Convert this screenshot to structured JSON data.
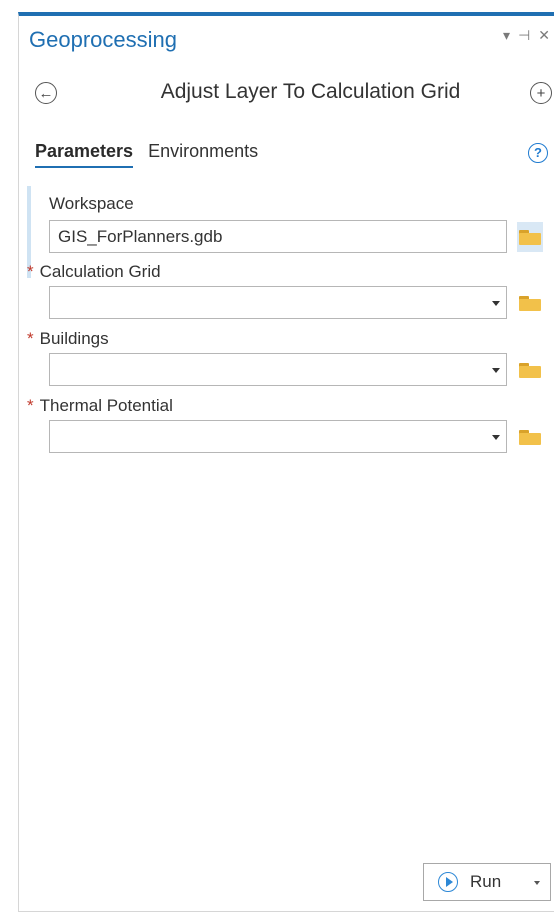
{
  "pane": {
    "title": "Geoprocessing",
    "controls": {
      "menu": "▾",
      "pin": "⊣",
      "close": "✕"
    }
  },
  "tool": {
    "title": "Adjust Layer To Calculation Grid"
  },
  "tabs": [
    {
      "label": "Parameters",
      "active": true
    },
    {
      "label": "Environments",
      "active": false
    }
  ],
  "help": "?",
  "parameters": [
    {
      "label": "Workspace",
      "required": false,
      "value": "GIS_ForPlanners.gdb",
      "type": "text"
    },
    {
      "label": "Calculation Grid",
      "required": true,
      "value": "",
      "type": "dropdown"
    },
    {
      "label": "Buildings",
      "required": true,
      "value": "",
      "type": "dropdown"
    },
    {
      "label": "Thermal Potential",
      "required": true,
      "value": "",
      "type": "dropdown"
    }
  ],
  "required_marker": "*",
  "run": {
    "label": "Run"
  },
  "icons": {
    "back": "back-arrow-icon",
    "add": "add-icon",
    "folder": "folder-icon",
    "help": "help-icon",
    "play": "play-icon"
  },
  "colors": {
    "accent": "#1f6fb2",
    "required": "#c0392b",
    "folder": "#f2c14a"
  }
}
